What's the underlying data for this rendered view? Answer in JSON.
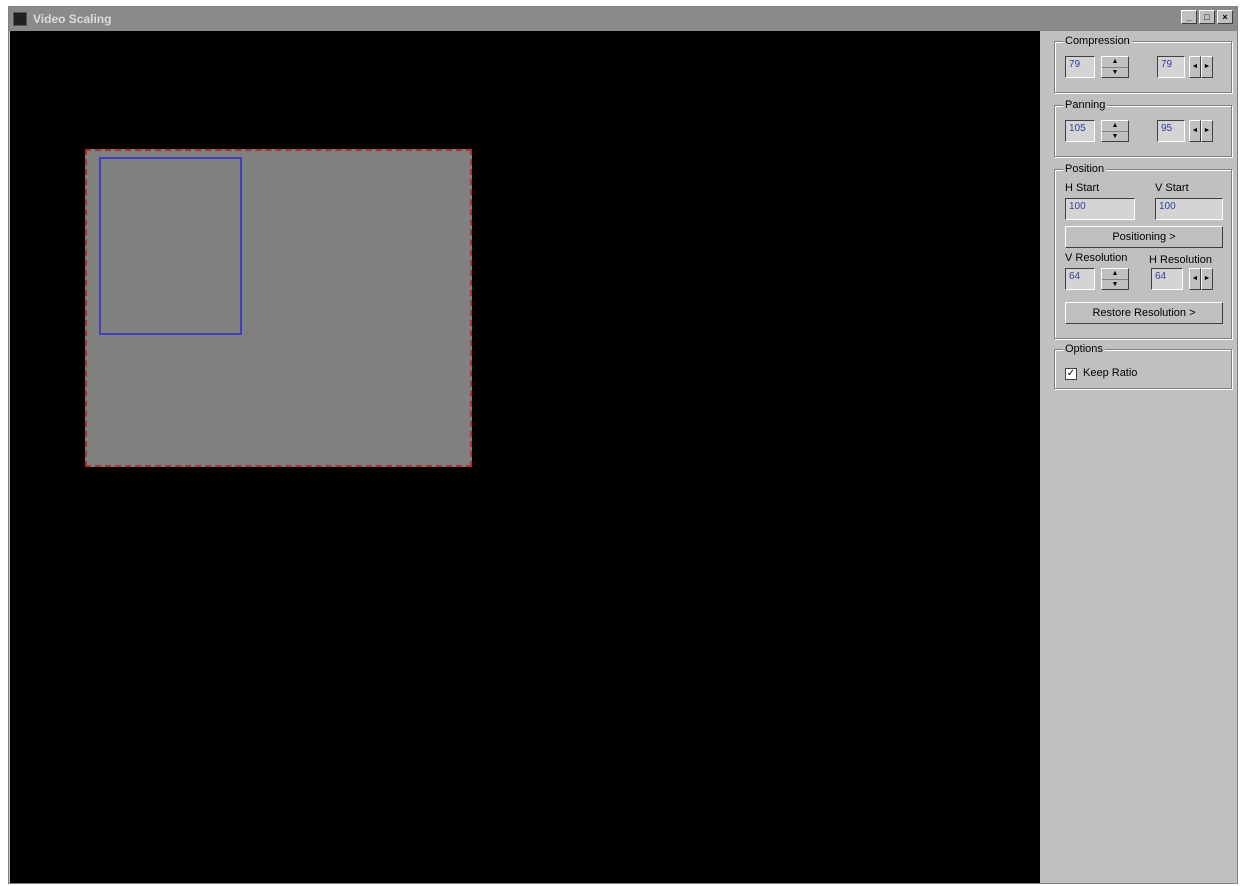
{
  "window": {
    "title": "Video Scaling",
    "controls": [
      "_",
      "□",
      "×"
    ]
  },
  "compression": {
    "label": "Compression",
    "value1": "79",
    "value2": "79"
  },
  "panning": {
    "label": "Panning",
    "value1": "105",
    "value2": "95"
  },
  "position": {
    "label": "Position",
    "h_start_label": "H Start",
    "v_start_label": "V Start",
    "h_start_value": "100",
    "v_start_value": "100",
    "positioning_button": "Positioning >",
    "v_resolution_label": "V Resolution",
    "h_resolution_label": "H Resolution",
    "v_resolution_value": "64",
    "h_resolution_value": "64",
    "restore_button": "Restore Resolution >"
  },
  "options": {
    "label": "Options",
    "keep_ratio_label": "Keep Ratio",
    "keep_ratio_checked": true
  },
  "icons": {
    "spin_up": "▲",
    "spin_down": "▼",
    "spin_left": "◄",
    "spin_right": "►",
    "check": "✓"
  },
  "colors": {
    "viewport": "#000000",
    "scaled_area": "#808080",
    "outer_border": "#b03030",
    "inner_border": "#4040c0"
  }
}
